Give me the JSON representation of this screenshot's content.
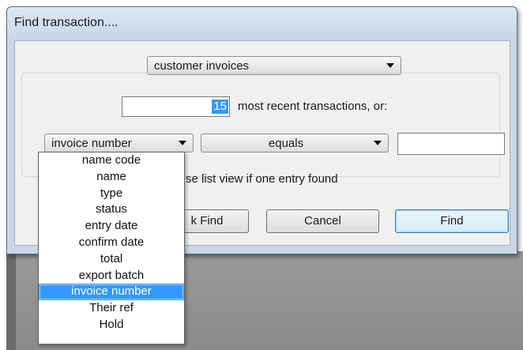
{
  "window": {
    "title": "Find transaction...."
  },
  "transaction_type": {
    "selected": "customer invoices"
  },
  "recent": {
    "count": "15",
    "label": "most recent transactions, or:"
  },
  "field_select": {
    "selected": "invoice number"
  },
  "operator_select": {
    "selected": "equals"
  },
  "search_value": {
    "value": ""
  },
  "checkbox_label_partial": "se list view if one entry found",
  "buttons": {
    "quick_find_partial": "k Find",
    "cancel": "Cancel",
    "find": "Find"
  },
  "dropdown": {
    "items": [
      {
        "label": "name code"
      },
      {
        "label": "name"
      },
      {
        "label": "type"
      },
      {
        "label": "status"
      },
      {
        "label": "entry date"
      },
      {
        "label": "confirm date"
      },
      {
        "label": "total"
      },
      {
        "label": "export batch"
      },
      {
        "label": "invoice number"
      },
      {
        "label": "Their ref"
      },
      {
        "label": "Hold"
      }
    ],
    "selected_index": 8
  }
}
